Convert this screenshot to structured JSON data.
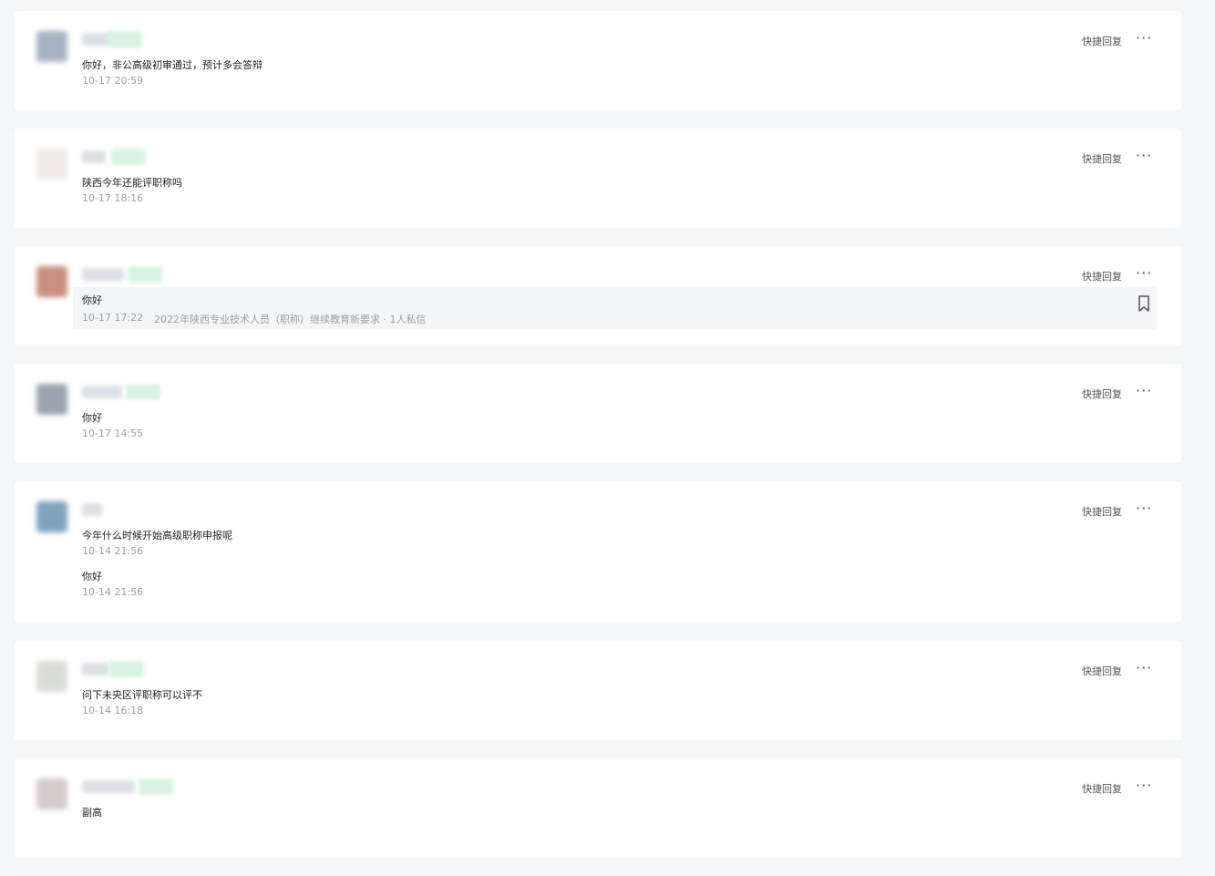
{
  "actions": {
    "quick_reply": "快捷回复",
    "more": "···"
  },
  "messages": [
    {
      "text": "你好，非公高级初审通过，预计多会答辩",
      "time": "10-17 20:59",
      "avatar_color": "#a9b4c2"
    },
    {
      "text": "陕西今年还能评职称吗",
      "time": "10-17 18:16",
      "avatar_color": "#efeae3"
    },
    {
      "text": "你好",
      "time": "10-17 17:22",
      "source": "2022年陕西专业技术人员（职称）继续教育新要求 · 1人私信",
      "avatar_color": "#c9907f"
    },
    {
      "text": "你好",
      "time": "10-17 14:55",
      "avatar_color": "#9aa4b1"
    },
    {
      "text": "今年什么时候开始高级职称申报呢",
      "time": "10-14 21:56",
      "text2": "你好",
      "time2": "10-14 21:56",
      "avatar_color": "#7fa3bd"
    },
    {
      "text": "问下未央区评职称可以评不",
      "time": "10-14 16:18",
      "avatar_color": "#d8dcd5"
    },
    {
      "text": "副高",
      "avatar_color": "#d6cacc"
    }
  ]
}
